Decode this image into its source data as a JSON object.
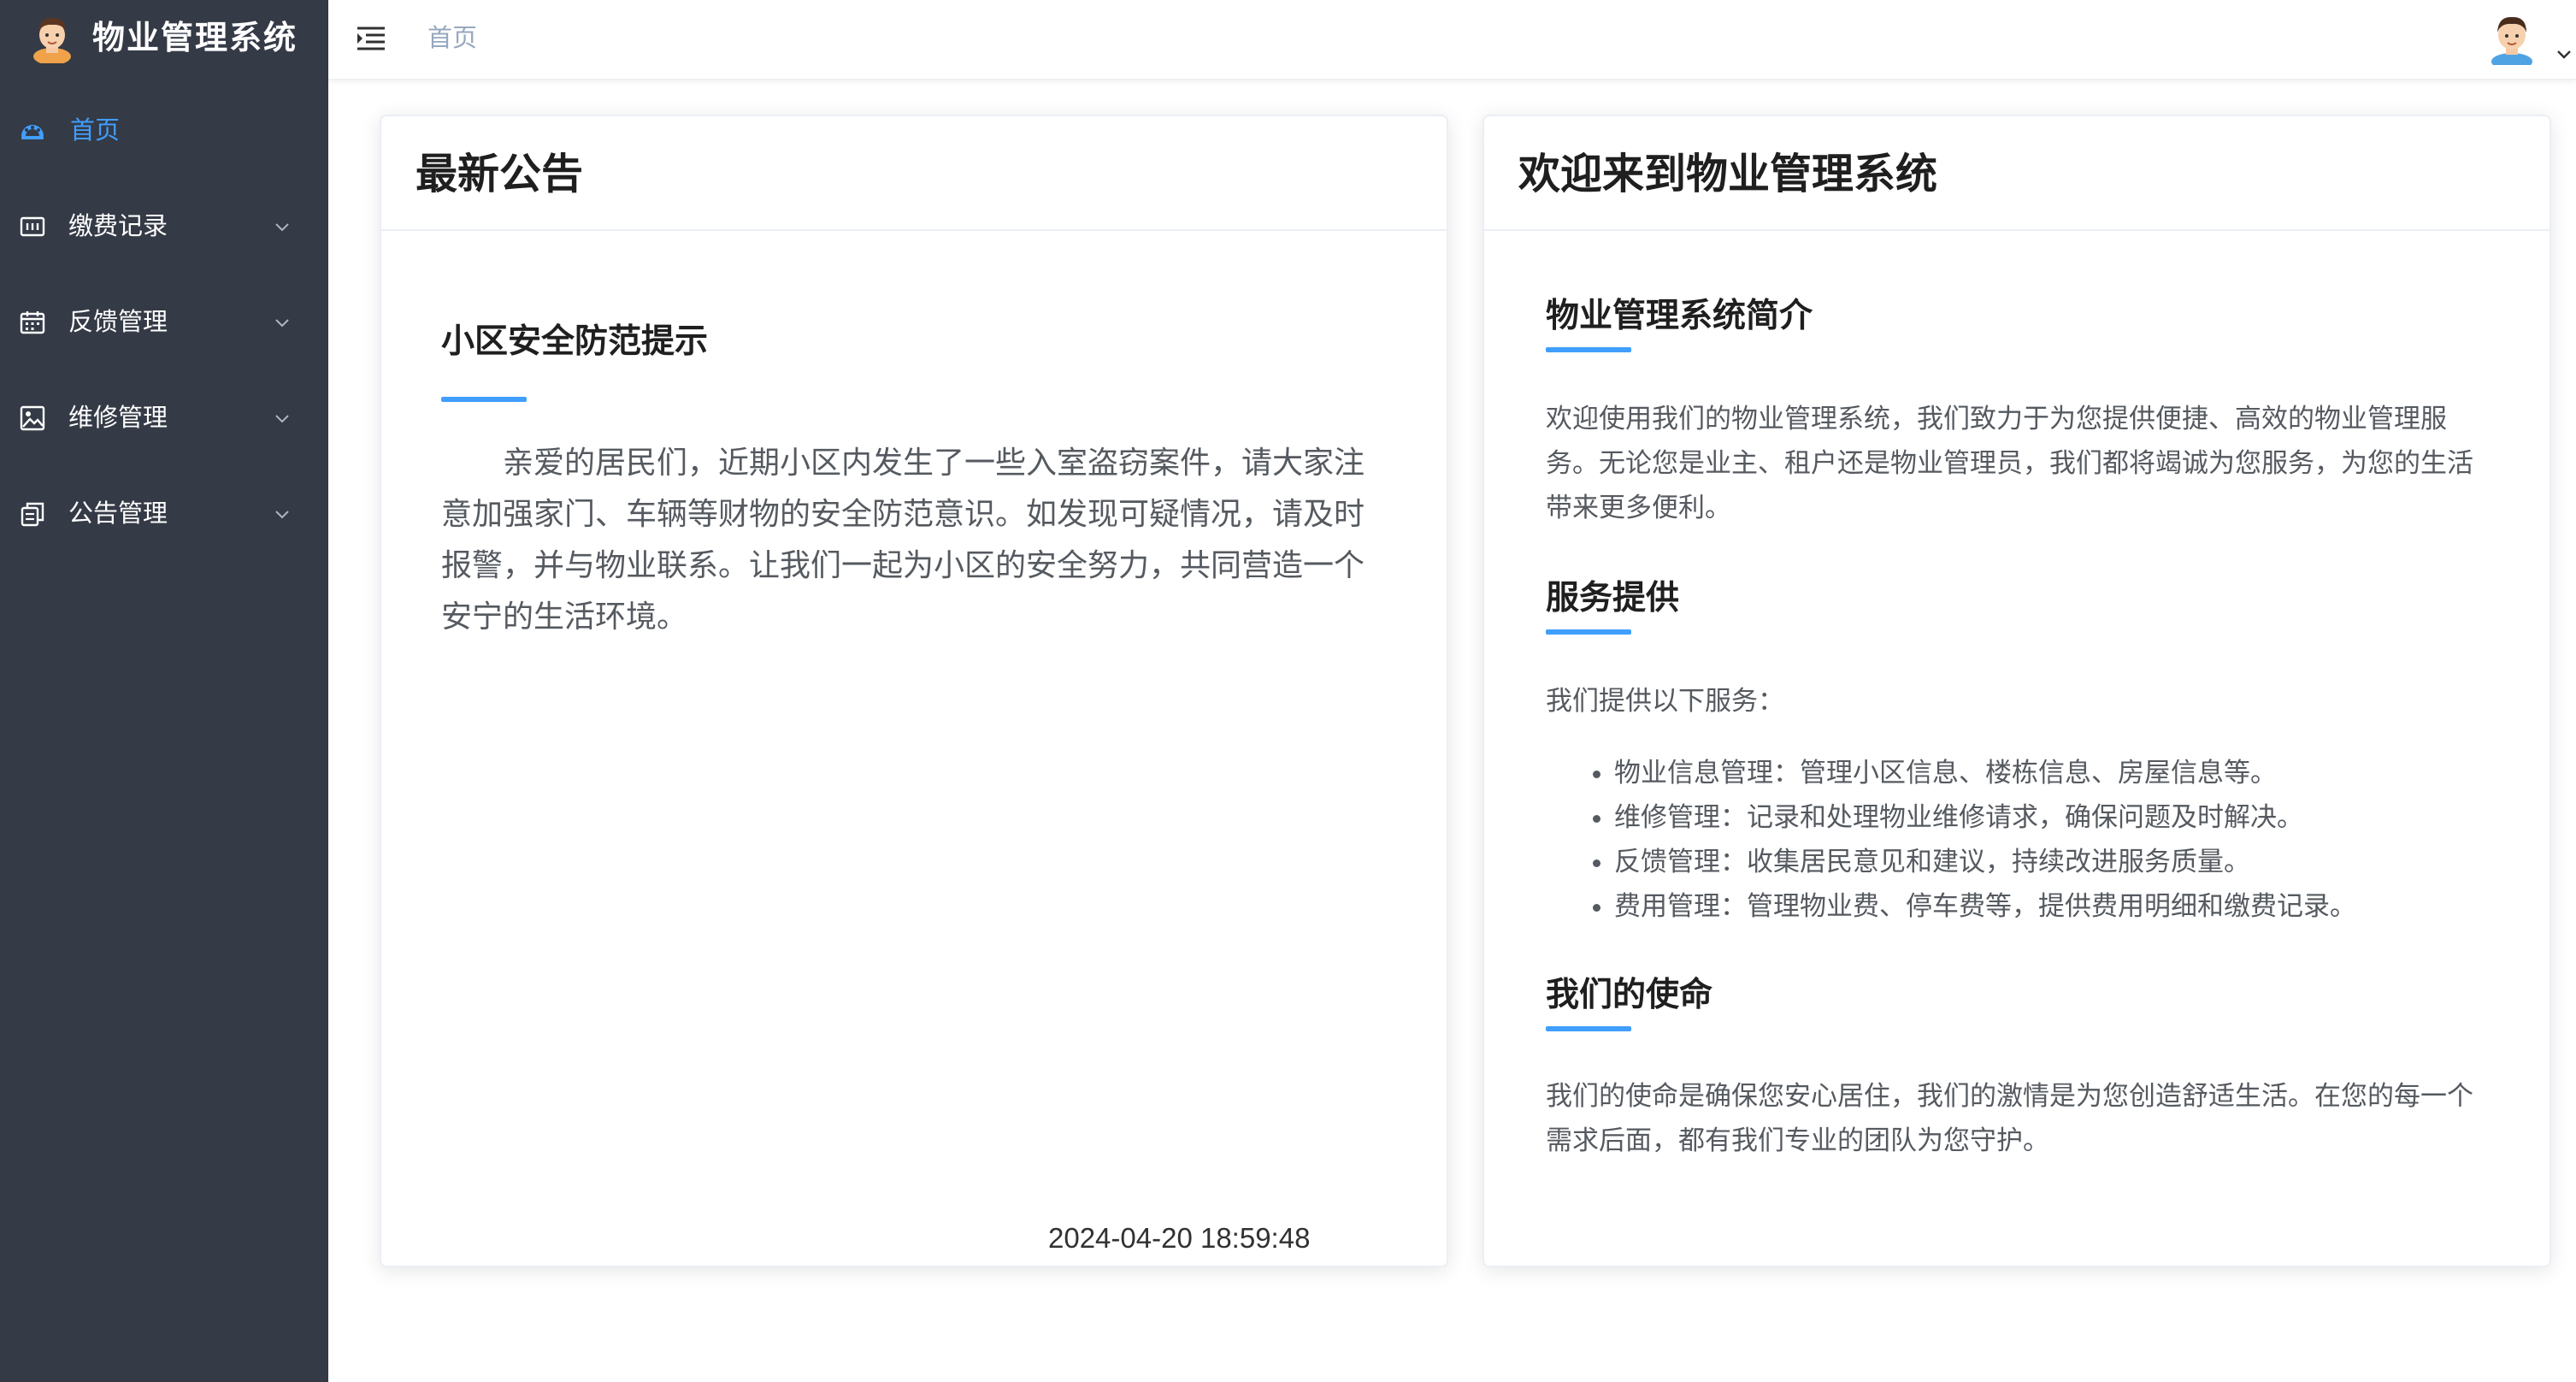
{
  "app": {
    "title": "物业管理系统"
  },
  "sidebar": {
    "items": [
      {
        "label": "首页",
        "icon": "dashboard-icon",
        "active": true,
        "expandable": false
      },
      {
        "label": "缴费记录",
        "icon": "payment-record-icon",
        "active": false,
        "expandable": true
      },
      {
        "label": "反馈管理",
        "icon": "calendar-icon",
        "active": false,
        "expandable": true
      },
      {
        "label": "维修管理",
        "icon": "image-icon",
        "active": false,
        "expandable": true
      },
      {
        "label": "公告管理",
        "icon": "document-copy-icon",
        "active": false,
        "expandable": true
      }
    ]
  },
  "header": {
    "breadcrumb": "首页"
  },
  "notice_card": {
    "title": "最新公告",
    "notice_title": "小区安全防范提示",
    "notice_body": "亲爱的居民们，近期小区内发生了一些入室盗窃案件，请大家注意加强家门、车辆等财物的安全防范意识。如发现可疑情况，请及时报警，并与物业联系。让我们一起为小区的安全努力，共同营造一个安宁的生活环境。",
    "notice_time": "2024-04-20 18:59:48"
  },
  "welcome_card": {
    "title": "欢迎来到物业管理系统",
    "intro_title": "物业管理系统简介",
    "intro_text": "欢迎使用我们的物业管理系统，我们致力于为您提供便捷、高效的物业管理服务。无论您是业主、租户还是物业管理员，我们都将竭诚为您服务，为您的生活带来更多便利。",
    "services_title": "服务提供",
    "services_intro": "我们提供以下服务：",
    "services": [
      "物业信息管理：管理小区信息、楼栋信息、房屋信息等。",
      "维修管理：记录和处理物业维修请求，确保问题及时解决。",
      "反馈管理：收集居民意见和建议，持续改进服务质量。",
      "费用管理：管理物业费、停车费等，提供费用明细和缴费记录。"
    ],
    "mission_title": "我们的使命",
    "mission_text": "我们的使命是确保您安心居住，我们的激情是为您创造舒适生活。在您的每一个需求后面，都有我们专业的团队为您守护。"
  },
  "colors": {
    "sidebar_bg": "#343a46",
    "accent": "#409eff",
    "breadcrumb": "#97a8be"
  }
}
